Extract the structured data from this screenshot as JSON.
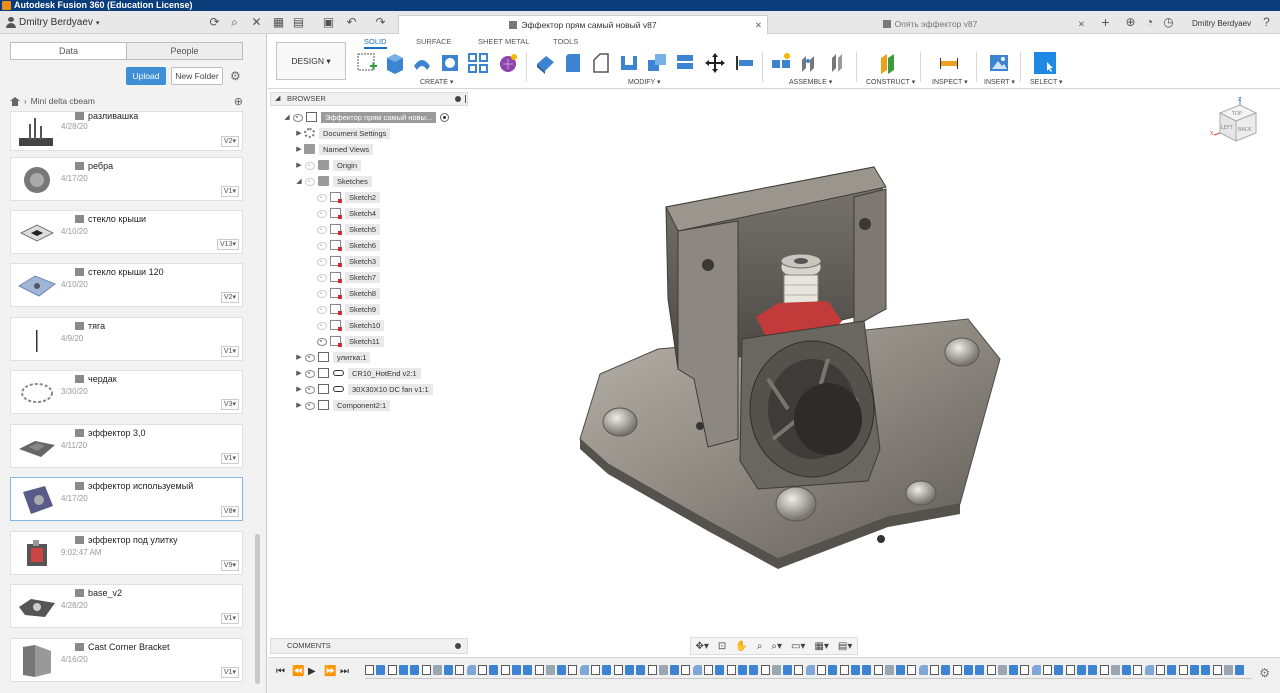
{
  "window": {
    "title": "Autodesk Fusion 360 (Education License)"
  },
  "top_bar": {
    "user": "Dmitry Berdyaev",
    "user_right": "Dmitry Berdyaev",
    "tabs": [
      {
        "label": "Эффектор прям самый новый v87",
        "active": true
      },
      {
        "label": "Опять эффектор v87",
        "active": false
      }
    ]
  },
  "data_panel": {
    "segment_tabs": [
      "Data",
      "People"
    ],
    "upload_label": "Upload",
    "new_folder_label": "New Folder",
    "breadcrumb": "Mini delta cbeam",
    "files": [
      {
        "name": "разливашка",
        "date": "4/28/20",
        "version": "V2"
      },
      {
        "name": "ребра",
        "date": "4/17/20",
        "version": "V1"
      },
      {
        "name": "стекло крыши",
        "date": "4/10/20",
        "version": "V13"
      },
      {
        "name": "стекло крыши 120",
        "date": "4/10/20",
        "version": "V2"
      },
      {
        "name": "тяга",
        "date": "4/9/20",
        "version": "V1"
      },
      {
        "name": "чердак",
        "date": "3/30/20",
        "version": "V3"
      },
      {
        "name": "эффектор 3,0",
        "date": "4/11/20",
        "version": "V1"
      },
      {
        "name": "эффектор используемый",
        "date": "4/17/20",
        "version": "V8"
      },
      {
        "name": "эффектор под улитку",
        "date": "9:02:47 AM",
        "version": "V9"
      },
      {
        "name": "base_v2",
        "date": "4/28/20",
        "version": "V1"
      },
      {
        "name": "Cast Corner Bracket",
        "date": "4/16/20",
        "version": "V1"
      }
    ]
  },
  "toolbar": {
    "design_label": "DESIGN",
    "workspace_tabs": [
      "SOLID",
      "SURFACE",
      "SHEET METAL",
      "TOOLS"
    ],
    "groups": [
      "CREATE",
      "MODIFY",
      "ASSEMBLE",
      "CONSTRUCT",
      "INSPECT",
      "INSERT",
      "SELECT"
    ]
  },
  "browser": {
    "header": "BROWSER",
    "root": "Эффектор прям самый новы...",
    "items": [
      {
        "label": "Document Settings"
      },
      {
        "label": "Named Views"
      },
      {
        "label": "Origin"
      },
      {
        "label": "Sketches"
      },
      {
        "label": "Sketch2"
      },
      {
        "label": "Sketch4"
      },
      {
        "label": "Sketch5"
      },
      {
        "label": "Sketch6"
      },
      {
        "label": "Sketch3"
      },
      {
        "label": "Sketch7"
      },
      {
        "label": "Sketch8"
      },
      {
        "label": "Sketch9"
      },
      {
        "label": "Sketch10"
      },
      {
        "label": "Sketch11"
      },
      {
        "label": "улитка:1"
      },
      {
        "label": "CR10_HotEnd v2:1"
      },
      {
        "label": "30X30X10 DC fan v1:1"
      },
      {
        "label": "Component2:1"
      }
    ]
  },
  "comments": {
    "label": "COMMENTS"
  },
  "viewcube": {
    "top": "TOP",
    "back": "BACK",
    "left": "LEFT"
  },
  "colors": {
    "accent": "#3e8fd6",
    "titlebar": "#0a3d7a"
  }
}
